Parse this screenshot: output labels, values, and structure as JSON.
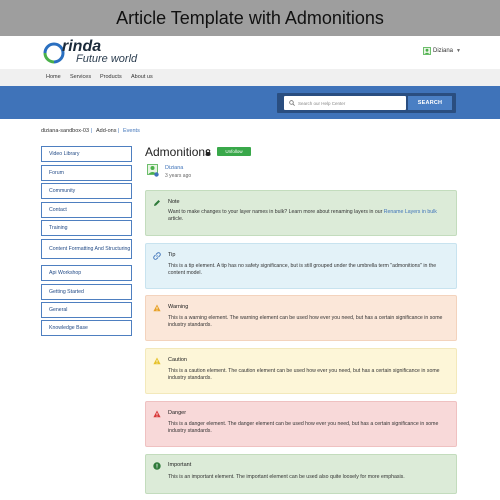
{
  "banner": {
    "title": "Article Template with Admonitions"
  },
  "brand": {
    "name": "rinda",
    "tagline": "Future world"
  },
  "user": {
    "name": "Diziana",
    "icon": "user-icon"
  },
  "nav": {
    "items": [
      "Home",
      "Services",
      "Products",
      "About us"
    ]
  },
  "search": {
    "placeholder": "Search our Help Center",
    "button_label": "SEARCH"
  },
  "breadcrumb": {
    "items": [
      "diziana-sandbox-03",
      "Add-ons",
      "Events"
    ],
    "separator": "|"
  },
  "sidebar": {
    "items": [
      "Video Library",
      "Forum",
      "Community",
      "Contact",
      "Training",
      "Content Formatting And Structuring",
      "Api Workshop",
      "Getting Started",
      "General",
      "Knowledge Base"
    ]
  },
  "article": {
    "title": "Admonitions",
    "lock_icon": "lock-icon",
    "badge": "Unfollow",
    "author": "Diziana",
    "time": "3 years ago"
  },
  "admonitions": [
    {
      "label": "Note",
      "icon": "pencil-icon",
      "bg": "#dcebd8",
      "border": "#c3dcbd",
      "body_before": "Want to make changes to your layer names in bulk? Learn more about renaming layers in our ",
      "link": "Rename Layers in bulk",
      "body_after": " article."
    },
    {
      "label": "Tip",
      "icon": "link-icon",
      "bg": "#e3f2f8",
      "border": "#c8e3ef",
      "body_before": "This is a tip element. A tip has no safety significance, but is still grouped under the umbrella term \"admonitions\" in the content model.",
      "link": "",
      "body_after": ""
    },
    {
      "label": "Warning",
      "icon": "warning-icon",
      "bg": "#fbe7d9",
      "border": "#f3d3bd",
      "body_before": "This is a warning element. The warning element can be used how ever you need, but has a certain significance in some industry standards.",
      "link": "",
      "body_after": ""
    },
    {
      "label": "Caution",
      "icon": "caution-icon",
      "bg": "#fdf6d8",
      "border": "#f3e9bb",
      "body_before": "This is a caution element. The caution element can be used how ever you need, but has a certain significance in some industry standards.",
      "link": "",
      "body_after": ""
    },
    {
      "label": "Danger",
      "icon": "danger-icon",
      "bg": "#f8d9d9",
      "border": "#efc1c1",
      "body_before": "This is a danger element. The danger element can be used how ever you need, but has a certain significance in some industry standards.",
      "link": "",
      "body_after": ""
    },
    {
      "label": "Important",
      "icon": "important-icon",
      "bg": "#dcebd8",
      "border": "#c3dcbd",
      "body_before": "This is an important element. The important element can be used also quite loosely for more emphasis.",
      "link": "",
      "body_after": ""
    }
  ],
  "colors": {
    "hero": "#3f73b9",
    "badge": "#39a84a",
    "link": "#3f73b9"
  }
}
